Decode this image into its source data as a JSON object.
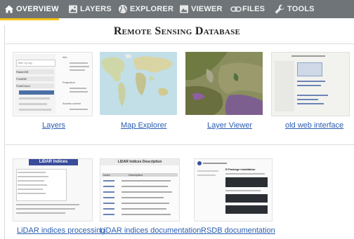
{
  "nav": {
    "items": [
      {
        "label": "OVERVIEW",
        "icon": "home-icon"
      },
      {
        "label": "LAYERS",
        "icon": "image-icon"
      },
      {
        "label": "EXPLORER",
        "icon": "globe-icon"
      },
      {
        "label": "VIEWER",
        "icon": "picture-icon"
      },
      {
        "label": "FILES",
        "icon": "link-icon"
      },
      {
        "label": "TOOLS",
        "icon": "wrench-icon"
      }
    ],
    "active_color": "#f4c21a",
    "bar_color": "#6e7478"
  },
  "page": {
    "title": "Remote Sensing Database"
  },
  "cards": [
    {
      "label": "Layers"
    },
    {
      "label": "Map Explorer"
    },
    {
      "label": "Layer Viewer"
    },
    {
      "label": "old web interface"
    },
    {
      "label": "LiDAR indices processing"
    },
    {
      "label": "LiDAR indices documentation"
    },
    {
      "label": "RSDB documentation"
    }
  ],
  "thumbs": {
    "layers": {
      "search_placeholder": "filter by tag",
      "rows": [
        "RasterDB",
        "PointDB",
        "PointCloud"
      ],
      "items": [
        "info",
        "Projection",
        "Access control"
      ]
    },
    "lidar_processing": {
      "title": "LiDAR Indices"
    },
    "lidar_docs": {
      "title": "LiDAR Indices Description",
      "col1": "Index",
      "col2": "Description"
    },
    "rsdb_docs": {
      "heading": "R Package installation"
    }
  }
}
